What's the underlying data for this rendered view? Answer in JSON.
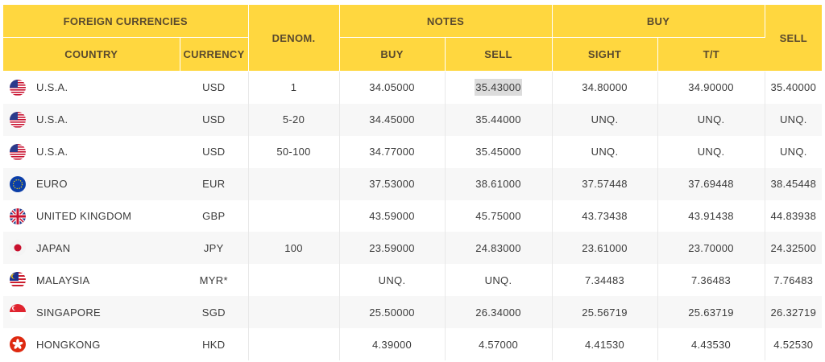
{
  "headers": {
    "foreign_currencies": "FOREIGN CURRENCIES",
    "country": "COUNTRY",
    "currency": "CURRENCY",
    "denom": "DENOM.",
    "notes": "NOTES",
    "notes_buy": "BUY",
    "notes_sell": "SELL",
    "buy": "BUY",
    "sight": "SIGHT",
    "tt": "T/T",
    "sell": "SELL"
  },
  "colors": {
    "header_bg": "#ffd73f",
    "header_text": "#5a4a2e",
    "stripe": "#f7f7f7",
    "highlight": "#dcdcdc"
  },
  "rows": [
    {
      "flag": "us-flag-icon",
      "country": "U.S.A.",
      "currency": "USD",
      "denom": "1",
      "notes_buy": "34.05000",
      "notes_sell": "35.43000",
      "sight": "34.80000",
      "tt": "34.90000",
      "sell": "35.40000"
    },
    {
      "flag": "us-flag-icon",
      "country": "U.S.A.",
      "currency": "USD",
      "denom": "5-20",
      "notes_buy": "34.45000",
      "notes_sell": "35.44000",
      "sight": "UNQ.",
      "tt": "UNQ.",
      "sell": "UNQ."
    },
    {
      "flag": "us-flag-icon",
      "country": "U.S.A.",
      "currency": "USD",
      "denom": "50-100",
      "notes_buy": "34.77000",
      "notes_sell": "35.45000",
      "sight": "UNQ.",
      "tt": "UNQ.",
      "sell": "UNQ."
    },
    {
      "flag": "eu-flag-icon",
      "country": "EURO",
      "currency": "EUR",
      "denom": "",
      "notes_buy": "37.53000",
      "notes_sell": "38.61000",
      "sight": "37.57448",
      "tt": "37.69448",
      "sell": "38.45448"
    },
    {
      "flag": "uk-flag-icon",
      "country": "UNITED KINGDOM",
      "currency": "GBP",
      "denom": "",
      "notes_buy": "43.59000",
      "notes_sell": "45.75000",
      "sight": "43.73438",
      "tt": "43.91438",
      "sell": "44.83938"
    },
    {
      "flag": "japan-flag-icon",
      "country": "JAPAN",
      "currency": "JPY",
      "denom": "100",
      "notes_buy": "23.59000",
      "notes_sell": "24.83000",
      "sight": "23.61000",
      "tt": "23.70000",
      "sell": "24.32500"
    },
    {
      "flag": "malaysia-flag-icon",
      "country": "MALAYSIA",
      "currency": "MYR*",
      "denom": "",
      "notes_buy": "UNQ.",
      "notes_sell": "UNQ.",
      "sight": "7.34483",
      "tt": "7.36483",
      "sell": "7.76483"
    },
    {
      "flag": "singapore-flag-icon",
      "country": "SINGAPORE",
      "currency": "SGD",
      "denom": "",
      "notes_buy": "25.50000",
      "notes_sell": "26.34000",
      "sight": "25.56719",
      "tt": "25.63719",
      "sell": "26.32719"
    },
    {
      "flag": "hongkong-flag-icon",
      "country": "HONGKONG",
      "currency": "HKD",
      "denom": "",
      "notes_buy": "4.39000",
      "notes_sell": "4.57000",
      "sight": "4.41530",
      "tt": "4.43530",
      "sell": "4.52530"
    }
  ]
}
